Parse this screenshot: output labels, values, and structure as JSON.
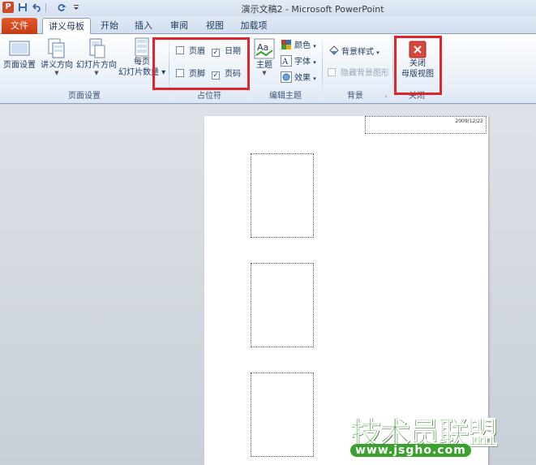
{
  "window": {
    "title": "演示文稿2 - Microsoft PowerPoint",
    "app_icon": "P",
    "quick_access": [
      "save-icon",
      "undo-icon",
      "redo-icon",
      "customize-icon"
    ]
  },
  "tabs": [
    {
      "label": "文件",
      "active": false,
      "file_tab": true
    },
    {
      "label": "讲义母板",
      "active": true
    },
    {
      "label": "开始",
      "active": false
    },
    {
      "label": "插入",
      "active": false
    },
    {
      "label": "审阅",
      "active": false
    },
    {
      "label": "视图",
      "active": false
    },
    {
      "label": "加载项",
      "active": false
    }
  ],
  "ribbon": {
    "page_setup": {
      "label": "页面设置",
      "page_setup_btn": "页面设置",
      "handout_orientation": "讲义方向",
      "slide_orientation": "幻灯片方向",
      "slides_per_page_line1": "每页",
      "slides_per_page_line2": "幻灯片数量"
    },
    "placeholders": {
      "label": "占位符",
      "header": {
        "label": "页眉",
        "checked": false
      },
      "date": {
        "label": "日期",
        "checked": true
      },
      "footer": {
        "label": "页脚",
        "checked": false
      },
      "page_number": {
        "label": "页码",
        "checked": true
      }
    },
    "edit_theme": {
      "label": "编辑主题",
      "themes": "主题",
      "colors": "颜色",
      "fonts": "字体",
      "effects": "效果"
    },
    "background": {
      "label": "背景",
      "background_styles": "背景样式",
      "hide_background_graphics": "隐藏背景图形"
    },
    "close": {
      "label": "关闭",
      "close_line1": "关闭",
      "close_line2": "母版视图"
    }
  },
  "page": {
    "date_text": "2009/12/22",
    "slide_placeholder_count": 3
  },
  "watermark": {
    "big": "技术员联盟",
    "small": "www.jsgho.com"
  },
  "colors": {
    "highlight_box": "#e0242a",
    "file_tab": "#d24726",
    "watermark": "#3aa12c"
  }
}
